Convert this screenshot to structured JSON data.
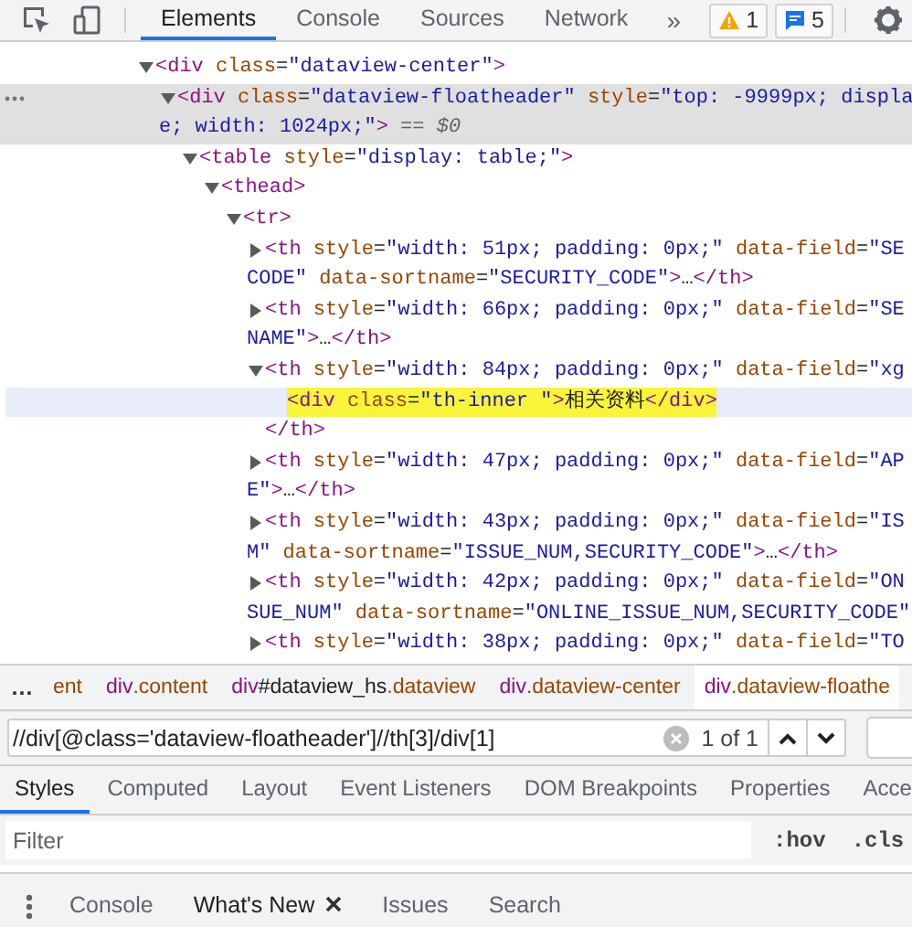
{
  "toolbar": {
    "tabs": [
      {
        "label": "Elements",
        "selected": true
      },
      {
        "label": "Console",
        "selected": false
      },
      {
        "label": "Sources",
        "selected": false
      },
      {
        "label": "Network",
        "selected": false
      }
    ],
    "more": "»",
    "warnings": "1",
    "messages": "5"
  },
  "dom_tree": [
    {
      "expanded": true,
      "lines": [
        [
          {
            "kind": "tag",
            "text": "<div"
          },
          {
            "kind": "attr",
            "text": " class"
          },
          {
            "kind": "plain",
            "text": "="
          },
          {
            "kind": "value",
            "text": "\"dataview-center\""
          },
          {
            "kind": "tag",
            "text": ">"
          }
        ]
      ],
      "children": [
        {
          "expanded": true,
          "selected": true,
          "lines": [
            [
              {
                "kind": "tag",
                "text": "<div"
              },
              {
                "kind": "attr",
                "text": " class"
              },
              {
                "kind": "plain",
                "text": "="
              },
              {
                "kind": "value",
                "text": "\"dataview-floatheader\""
              },
              {
                "kind": "attr",
                "text": " style"
              },
              {
                "kind": "plain",
                "text": "="
              },
              {
                "kind": "value",
                "text": "\"top: -9999px; displa"
              }
            ],
            [
              {
                "kind": "value",
                "text": "e; width: 1024px;\""
              },
              {
                "kind": "tag",
                "text": ">"
              },
              {
                "kind": "note",
                "text": " == "
              },
              {
                "kind": "var",
                "text": "$0"
              }
            ]
          ],
          "children": [
            {
              "expanded": true,
              "lines": [
                [
                  {
                    "kind": "tag",
                    "text": "<table"
                  },
                  {
                    "kind": "attr",
                    "text": " style"
                  },
                  {
                    "kind": "plain",
                    "text": "="
                  },
                  {
                    "kind": "value",
                    "text": "\"display: table;\""
                  },
                  {
                    "kind": "tag",
                    "text": ">"
                  }
                ]
              ],
              "children": [
                {
                  "expanded": true,
                  "lines": [
                    [
                      {
                        "kind": "tag",
                        "text": "<thead>"
                      }
                    ]
                  ],
                  "children": [
                    {
                      "expanded": true,
                      "lines": [
                        [
                          {
                            "kind": "tag",
                            "text": "<tr>"
                          }
                        ]
                      ],
                      "children": [
                        {
                          "expanded": false,
                          "lines": [
                            [
                              {
                                "kind": "tag",
                                "text": "<th"
                              },
                              {
                                "kind": "attr",
                                "text": " style"
                              },
                              {
                                "kind": "plain",
                                "text": "="
                              },
                              {
                                "kind": "value",
                                "text": "\"width: 51px; padding: 0px;\""
                              },
                              {
                                "kind": "attr",
                                "text": " data-field"
                              },
                              {
                                "kind": "plain",
                                "text": "="
                              },
                              {
                                "kind": "value",
                                "text": "\"SE"
                              }
                            ],
                            [
                              {
                                "kind": "value",
                                "text": "CODE\""
                              },
                              {
                                "kind": "attr",
                                "text": " data-sortname"
                              },
                              {
                                "kind": "plain",
                                "text": "="
                              },
                              {
                                "kind": "value",
                                "text": "\"SECURITY_CODE\""
                              },
                              {
                                "kind": "tag",
                                "text": ">"
                              },
                              {
                                "kind": "plain",
                                "text": "…"
                              },
                              {
                                "kind": "tag",
                                "text": "</th>"
                              }
                            ]
                          ]
                        },
                        {
                          "expanded": false,
                          "lines": [
                            [
                              {
                                "kind": "tag",
                                "text": "<th"
                              },
                              {
                                "kind": "attr",
                                "text": " style"
                              },
                              {
                                "kind": "plain",
                                "text": "="
                              },
                              {
                                "kind": "value",
                                "text": "\"width: 66px; padding: 0px;\""
                              },
                              {
                                "kind": "attr",
                                "text": " data-field"
                              },
                              {
                                "kind": "plain",
                                "text": "="
                              },
                              {
                                "kind": "value",
                                "text": "\"SE"
                              }
                            ],
                            [
                              {
                                "kind": "value",
                                "text": "NAME\""
                              },
                              {
                                "kind": "tag",
                                "text": ">"
                              },
                              {
                                "kind": "plain",
                                "text": "…"
                              },
                              {
                                "kind": "tag",
                                "text": "</th>"
                              }
                            ]
                          ]
                        },
                        {
                          "expanded": true,
                          "lines": [
                            [
                              {
                                "kind": "tag",
                                "text": "<th"
                              },
                              {
                                "kind": "attr",
                                "text": " style"
                              },
                              {
                                "kind": "plain",
                                "text": "="
                              },
                              {
                                "kind": "value",
                                "text": "\"width: 84px; padding: 0px;\""
                              },
                              {
                                "kind": "attr",
                                "text": " data-field"
                              },
                              {
                                "kind": "plain",
                                "text": "="
                              },
                              {
                                "kind": "value",
                                "text": "\"xg"
                              }
                            ]
                          ],
                          "children": [
                            {
                              "hovered": true,
                              "search_match": true,
                              "lines": [
                                [
                                  {
                                    "kind": "tag",
                                    "text": "<div"
                                  },
                                  {
                                    "kind": "attr",
                                    "text": " class"
                                  },
                                  {
                                    "kind": "plain",
                                    "text": "="
                                  },
                                  {
                                    "kind": "value",
                                    "text": "\"th-inner \""
                                  },
                                  {
                                    "kind": "tag",
                                    "text": ">"
                                  },
                                  {
                                    "kind": "plain",
                                    "text": "相关资料"
                                  },
                                  {
                                    "kind": "tag",
                                    "text": "</div>"
                                  }
                                ]
                              ]
                            }
                          ],
                          "closing": [
                            {
                              "kind": "tag",
                              "text": "</th>"
                            }
                          ]
                        },
                        {
                          "expanded": false,
                          "lines": [
                            [
                              {
                                "kind": "tag",
                                "text": "<th"
                              },
                              {
                                "kind": "attr",
                                "text": " style"
                              },
                              {
                                "kind": "plain",
                                "text": "="
                              },
                              {
                                "kind": "value",
                                "text": "\"width: 47px; padding: 0px;\""
                              },
                              {
                                "kind": "attr",
                                "text": " data-field"
                              },
                              {
                                "kind": "plain",
                                "text": "="
                              },
                              {
                                "kind": "value",
                                "text": "\"AP"
                              }
                            ],
                            [
                              {
                                "kind": "value",
                                "text": "E\""
                              },
                              {
                                "kind": "tag",
                                "text": ">"
                              },
                              {
                                "kind": "plain",
                                "text": "…"
                              },
                              {
                                "kind": "tag",
                                "text": "</th>"
                              }
                            ]
                          ]
                        },
                        {
                          "expanded": false,
                          "lines": [
                            [
                              {
                                "kind": "tag",
                                "text": "<th"
                              },
                              {
                                "kind": "attr",
                                "text": " style"
                              },
                              {
                                "kind": "plain",
                                "text": "="
                              },
                              {
                                "kind": "value",
                                "text": "\"width: 43px; padding: 0px;\""
                              },
                              {
                                "kind": "attr",
                                "text": " data-field"
                              },
                              {
                                "kind": "plain",
                                "text": "="
                              },
                              {
                                "kind": "value",
                                "text": "\"IS"
                              }
                            ],
                            [
                              {
                                "kind": "value",
                                "text": "M\""
                              },
                              {
                                "kind": "attr",
                                "text": " data-sortname"
                              },
                              {
                                "kind": "plain",
                                "text": "="
                              },
                              {
                                "kind": "value",
                                "text": "\"ISSUE_NUM,SECURITY_CODE\""
                              },
                              {
                                "kind": "tag",
                                "text": ">"
                              },
                              {
                                "kind": "plain",
                                "text": "…"
                              },
                              {
                                "kind": "tag",
                                "text": "</th>"
                              }
                            ]
                          ]
                        },
                        {
                          "expanded": false,
                          "lines": [
                            [
                              {
                                "kind": "tag",
                                "text": "<th"
                              },
                              {
                                "kind": "attr",
                                "text": " style"
                              },
                              {
                                "kind": "plain",
                                "text": "="
                              },
                              {
                                "kind": "value",
                                "text": "\"width: 42px; padding: 0px;\""
                              },
                              {
                                "kind": "attr",
                                "text": " data-field"
                              },
                              {
                                "kind": "plain",
                                "text": "="
                              },
                              {
                                "kind": "value",
                                "text": "\"ON"
                              }
                            ],
                            [
                              {
                                "kind": "value",
                                "text": "SUE_NUM\""
                              },
                              {
                                "kind": "attr",
                                "text": " data-sortname"
                              },
                              {
                                "kind": "plain",
                                "text": "="
                              },
                              {
                                "kind": "value",
                                "text": "\"ONLINE_ISSUE_NUM,SECURITY_CODE\""
                              }
                            ]
                          ]
                        },
                        {
                          "expanded": false,
                          "lines": [
                            [
                              {
                                "kind": "tag",
                                "text": "<th"
                              },
                              {
                                "kind": "attr",
                                "text": " style"
                              },
                              {
                                "kind": "plain",
                                "text": "="
                              },
                              {
                                "kind": "value",
                                "text": "\"width: 38px; padding: 0px;\""
                              },
                              {
                                "kind": "attr",
                                "text": " data-field"
                              },
                              {
                                "kind": "plain",
                                "text": "="
                              },
                              {
                                "kind": "value",
                                "text": "\"TO"
                              }
                            ]
                          ]
                        }
                      ]
                    }
                  ]
                }
              ]
            }
          ]
        }
      ]
    }
  ],
  "breadcrumbs_overflow": "…",
  "breadcrumbs": [
    {
      "selected": false,
      "tokens": [
        {
          "kind": "attr",
          "text": "ent"
        }
      ]
    },
    {
      "selected": false,
      "tokens": [
        {
          "kind": "tag",
          "text": "div"
        },
        {
          "kind": "attr",
          "text": ".content"
        }
      ]
    },
    {
      "selected": false,
      "tokens": [
        {
          "kind": "tag",
          "text": "div"
        },
        {
          "kind": "plain",
          "text": "#dataview_hs"
        },
        {
          "kind": "attr",
          "text": ".dataview"
        }
      ]
    },
    {
      "selected": false,
      "tokens": [
        {
          "kind": "tag",
          "text": "div"
        },
        {
          "kind": "attr",
          "text": ".dataview-center"
        }
      ]
    },
    {
      "selected": true,
      "tokens": [
        {
          "kind": "tag",
          "text": "div"
        },
        {
          "kind": "attr",
          "text": ".dataview-floathe"
        }
      ]
    }
  ],
  "search": {
    "value": "//div[@class='dataview-floatheader']//th[3]/div[1]",
    "count": "1 of 1"
  },
  "styles_tabs": [
    {
      "label": "Styles",
      "selected": true
    },
    {
      "label": "Computed",
      "selected": false
    },
    {
      "label": "Layout",
      "selected": false
    },
    {
      "label": "Event Listeners",
      "selected": false
    },
    {
      "label": "DOM Breakpoints",
      "selected": false
    },
    {
      "label": "Properties",
      "selected": false
    },
    {
      "label": "Acce",
      "selected": false
    }
  ],
  "filter": {
    "placeholder": "Filter",
    "buttons": [
      ":hov",
      ".cls"
    ]
  },
  "drawer_tabs": [
    {
      "label": "Console",
      "selected": false,
      "closable": false
    },
    {
      "label": "What's New",
      "selected": true,
      "closable": true
    },
    {
      "label": "Issues",
      "selected": false,
      "closable": false
    },
    {
      "label": "Search",
      "selected": false,
      "closable": false
    }
  ]
}
